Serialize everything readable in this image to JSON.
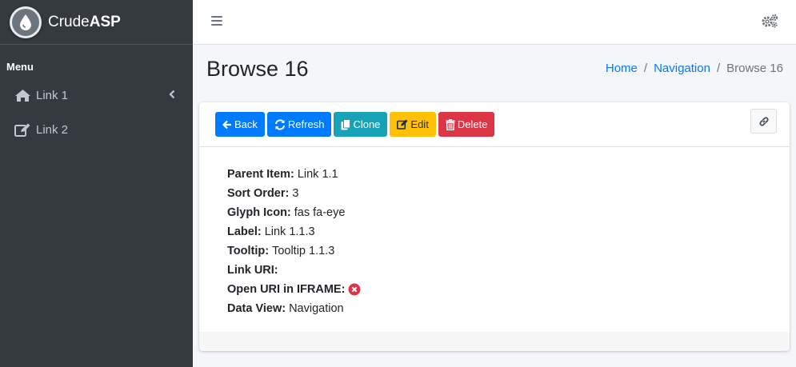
{
  "brand": {
    "name_light": "Crude",
    "name_bold": "ASP",
    "logo_icon": "droplet-icon"
  },
  "sidebar": {
    "menu_header": "Menu",
    "items": [
      {
        "label": "Link 1",
        "icon": "home-icon",
        "has_children": true
      },
      {
        "label": "Link 2",
        "icon": "edit-icon",
        "has_children": false
      }
    ]
  },
  "navbar": {
    "menu_icon": "hamburger-icon",
    "settings_icon": "gears-icon"
  },
  "page": {
    "title": "Browse 16",
    "breadcrumb": [
      {
        "label": "Home",
        "link": true
      },
      {
        "label": "Navigation",
        "link": true
      },
      {
        "label": "Browse 16",
        "link": false
      }
    ]
  },
  "toolbar": {
    "back_label": "Back",
    "refresh_label": "Refresh",
    "clone_label": "Clone",
    "edit_label": "Edit",
    "delete_label": "Delete",
    "link_icon": "link-icon"
  },
  "record": {
    "fields": [
      {
        "label": "Parent Item:",
        "value": "Link 1.1"
      },
      {
        "label": "Sort Order:",
        "value": "3"
      },
      {
        "label": "Glyph Icon:",
        "value": "fas fa-eye"
      },
      {
        "label": "Label:",
        "value": "Link 1.1.3"
      },
      {
        "label": "Tooltip:",
        "value": "Tooltip 1.1.3"
      },
      {
        "label": "Link URI:",
        "value": ""
      },
      {
        "label": "Open URI in IFRAME:",
        "value": "",
        "icon": "times-circle-icon"
      },
      {
        "label": "Data View:",
        "value": "Navigation"
      }
    ]
  },
  "colors": {
    "primary": "#007bff",
    "info": "#17a2b8",
    "warning": "#ffc107",
    "danger": "#dc3545",
    "sidebar": "#343a40"
  }
}
